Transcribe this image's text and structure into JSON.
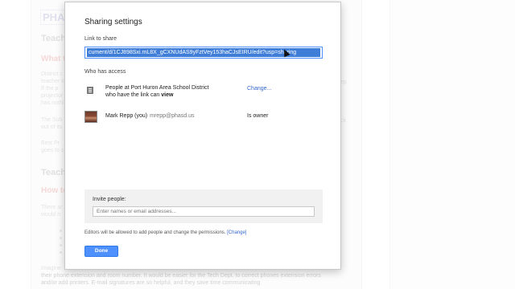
{
  "background_doc": {
    "title": "PHASE",
    "lines": [
      {
        "text": "Teach",
        "kind": "h"
      },
      {
        "text": "What t",
        "kind": "red"
      },
      {
        "text": "District c",
        "kind": "p"
      },
      {
        "text": "teacher k",
        "kind": "p"
      },
      {
        "text": "If the p",
        "kind": "p"
      },
      {
        "text": "projector",
        "kind": "p"
      },
      {
        "text": "has nothi",
        "kind": "p"
      },
      {
        "text": "The Sub",
        "kind": "p"
      },
      {
        "text": "out of its",
        "kind": "p"
      },
      {
        "text": "Best Pr",
        "kind": "p"
      },
      {
        "text": "goes to s",
        "kind": "p"
      },
      {
        "text": "Teachi",
        "kind": "h"
      },
      {
        "text": "How to",
        "kind": "red"
      },
      {
        "text": "There ar",
        "kind": "p"
      },
      {
        "text": "would n",
        "kind": "p"
      },
      {
        "text": "Imagine",
        "kind": "p"
      }
    ],
    "bottom_lines": [
      "their phone extension and room number. It would be easier for the Tech Dept. to correct phones extension errors",
      "and/or add printers. E-mail signatures are so helpful, and they save time communicating"
    ],
    "right_snippets": [
      "ep",
      "ck"
    ]
  },
  "dialog": {
    "title": "Sharing settings",
    "link_label": "Link to share",
    "link_value": "cument/d/1CJ898Sxi.mL8X_gCXNUdAS9yFztVey153haCJsEIRU/edit?usp=sharing",
    "access_label": "Who has access",
    "access_rows": [
      {
        "icon": "domain-icon",
        "line1": "People at Port Huron Area School District",
        "line2_prefix": "who have the link can ",
        "line2_bold": "view",
        "action": "Change..."
      },
      {
        "icon": "avatar",
        "name": "Mark Repp (you)",
        "email": "mrepp@phasd.us",
        "role": "Is owner"
      }
    ],
    "invite_label": "Invite people:",
    "invite_placeholder": "Enter names or email addresses...",
    "permission_note": "Editors will be allowed to add people and change the permissions.",
    "permission_change": "[Change]",
    "done_label": "Done"
  },
  "colors": {
    "accent": "#4d90fe",
    "link": "#3366cc",
    "selection": "#3f7ed8"
  }
}
